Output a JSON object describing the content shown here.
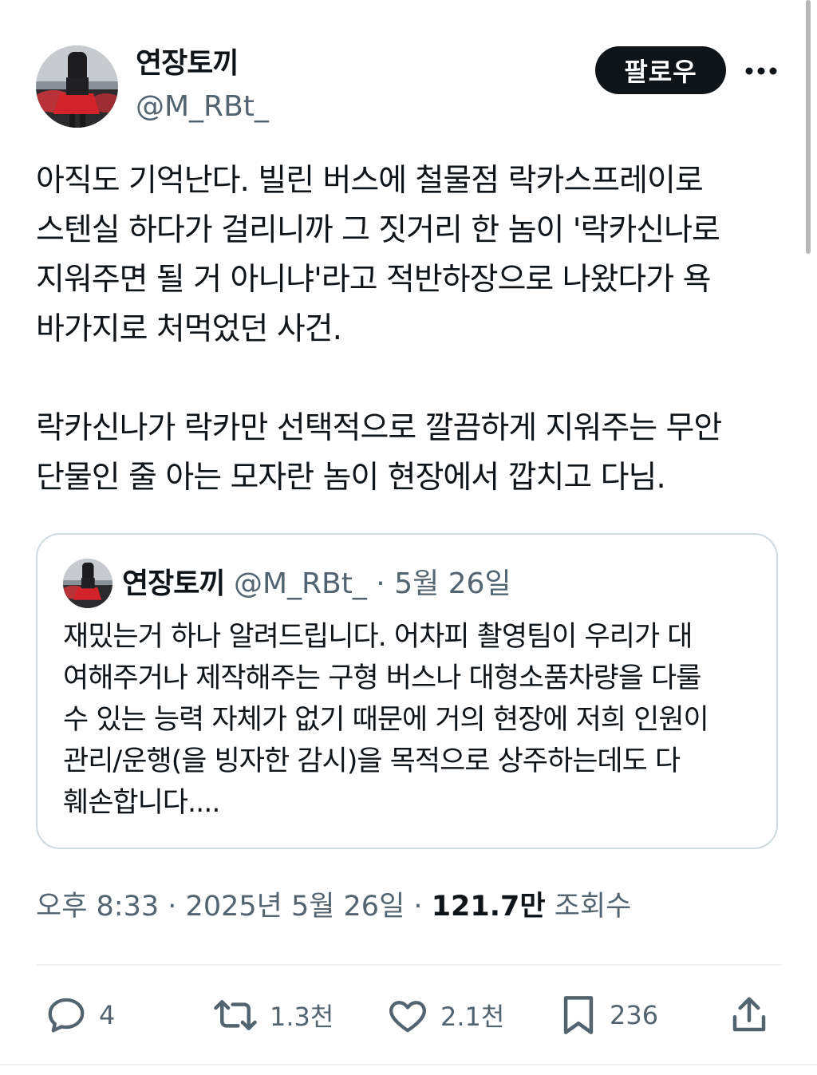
{
  "author": {
    "display_name": "연장토끼",
    "handle": "@M_RBt_"
  },
  "follow_button": {
    "label": "팔로우"
  },
  "more_icon": "more-horizontal-icon",
  "tweet": {
    "paragraphs": [
      "아직도 기억난다. 빌린 버스에 철물점 락카스프레이로 스텐실 하다가 걸리니까 그 짓거리 한 놈이 '락카신나로 지워주면 될 거 아니냐'라고 적반하장으로 나왔다가 욕바가지로 처먹었던 사건.",
      "락카신나가 락카만 선택적으로 깔끔하게 지워주는 무안단물인 줄 아는 모자란 놈이 현장에서 깝치고 다님."
    ],
    "lines": [
      "아직도 기억난다. 빌린 버스에 철물점 락카스프레이로",
      "스텐실 하다가 걸리니까 그 짓거리 한 놈이 '락카신나로",
      "지워주면 될 거 아니냐'라고 적반하장으로 나왔다가 욕",
      "바가지로 처먹었던 사건.",
      "락카신나가 락카만 선택적으로 깔끔하게 지워주는 무안",
      "단물인 줄 아는 모자란 놈이 현장에서 깝치고 다님."
    ]
  },
  "quote": {
    "display_name": "연장토끼",
    "handle": "@M_RBt_",
    "separator": "·",
    "date": "5월 26일",
    "lines": [
      "재밌는거 하나 알려드립니다. 어차피 촬영팀이 우리가 대",
      "여해주거나 제작해주는 구형 버스나 대형소품차량을 다룰",
      "수 있는 능력 자체가 없기 때문에 거의 현장에 저희 인원이",
      "관리/운행(을 빙자한 감시)을 목적으로 상주하는데도 다",
      "훼손합니다...."
    ]
  },
  "meta": {
    "time": "오후 8:33",
    "separator": "·",
    "date": "2025년 5월 26일",
    "views_count": "121.7만",
    "views_label": "조회수"
  },
  "actions": {
    "reply": {
      "icon": "reply-icon",
      "count": "4"
    },
    "retweet": {
      "icon": "retweet-icon",
      "count": "1.3천"
    },
    "like": {
      "icon": "heart-icon",
      "count": "2.1천"
    },
    "bookmark": {
      "icon": "bookmark-icon",
      "count": "236"
    },
    "share": {
      "icon": "share-icon"
    }
  },
  "colors": {
    "text_primary": "#0f1419",
    "text_secondary": "#536471",
    "border": "#cfd9de",
    "button_bg": "#0f1419"
  }
}
